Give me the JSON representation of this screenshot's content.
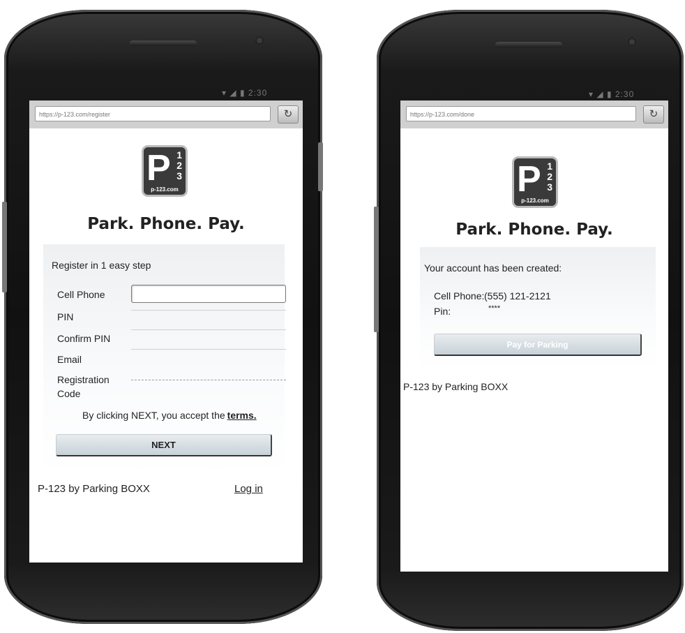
{
  "left_phone": {
    "status_time": "2:30",
    "url": "https://p-123.com/register",
    "reload_icon": "reload-icon",
    "logo": {
      "letter": "P",
      "digits": [
        "1",
        "2",
        "3"
      ],
      "domain": "p-123.com"
    },
    "tagline": "Park. Phone. Pay.",
    "form": {
      "heading": "Register in 1 easy step",
      "fields": {
        "cell_phone": "Cell Phone",
        "pin": "PIN",
        "confirm_pin": "Confirm PIN",
        "email": "Email",
        "registration_line1": "Registration",
        "registration_line2": "Code"
      },
      "terms_prefix": "By clicking NEXT, you accept the",
      "terms_link": "terms.",
      "next_label": "NEXT"
    },
    "footer": {
      "brand": "P-123 by Parking BOXX",
      "login_link": "Log in"
    }
  },
  "right_phone": {
    "status_time": "2:30",
    "url": "https://p-123.com/done",
    "reload_icon": "reload-icon",
    "logo": {
      "letter": "P",
      "digits": [
        "1",
        "2",
        "3"
      ],
      "domain": "p-123.com"
    },
    "tagline": "Park. Phone. Pay.",
    "panel": {
      "heading": "Your account has been created:",
      "cell_label": "Cell Phone:",
      "cell_value": "(555) 121-2121",
      "pin_label": "Pin:",
      "pin_value": "****",
      "button_label": "Pay for Parking"
    },
    "footer": {
      "brand": "P-123 by Parking BOXX"
    }
  }
}
